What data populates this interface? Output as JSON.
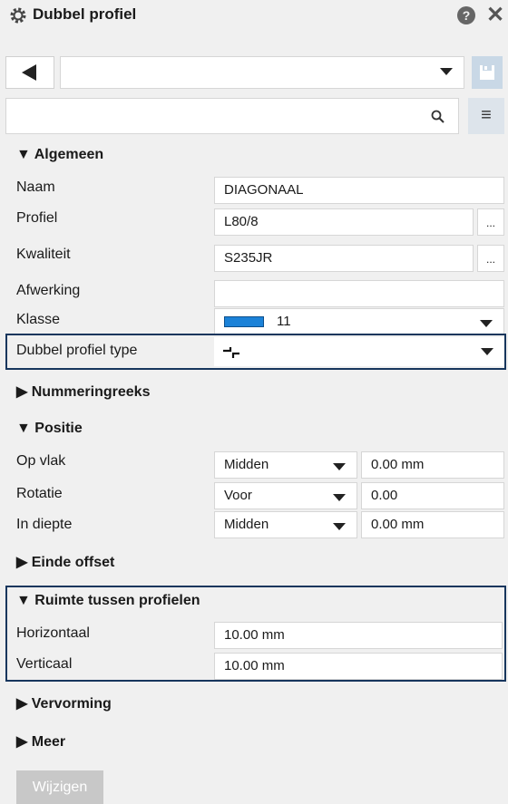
{
  "window": {
    "title": "Dubbel profiel",
    "help_icon": "?",
    "close_icon": "✕"
  },
  "toolbar": {
    "preset_value": "",
    "search_value": "",
    "filter_icon": "≡"
  },
  "sections": {
    "algemeen": "▼ Algemeen",
    "nummering": "▶ Nummeringreeks",
    "positie": "▼ Positie",
    "einde_offset": "▶ Einde offset",
    "ruimte": "▼ Ruimte tussen profielen",
    "vervorming": "▶ Vervorming",
    "meer": "▶ Meer"
  },
  "algemeen": {
    "naam_label": "Naam",
    "naam_value": "DIAGONAAL",
    "profiel_label": "Profiel",
    "profiel_value": "L80/8",
    "kwaliteit_label": "Kwaliteit",
    "kwaliteit_value": "S235JR",
    "afwerking_label": "Afwerking",
    "afwerking_value": "",
    "klasse_label": "Klasse",
    "klasse_value": "11",
    "klasse_color": "#1b82d8",
    "type_label": "Dubbel profiel type",
    "type_value": "⌐┌",
    "ellipsis": "..."
  },
  "positie": {
    "opvlak_label": "Op vlak",
    "opvlak_select": "Midden",
    "opvlak_value": "0.00 mm",
    "rotatie_label": "Rotatie",
    "rotatie_select": "Voor",
    "rotatie_value": "0.00",
    "diepte_label": "In diepte",
    "diepte_select": "Midden",
    "diepte_value": "0.00 mm"
  },
  "ruimte": {
    "horizontaal_label": "Horizontaal",
    "horizontaal_value": "10.00 mm",
    "verticaal_label": "Verticaal",
    "verticaal_value": "10.00 mm"
  },
  "footer": {
    "apply_label": "Wijzigen"
  }
}
